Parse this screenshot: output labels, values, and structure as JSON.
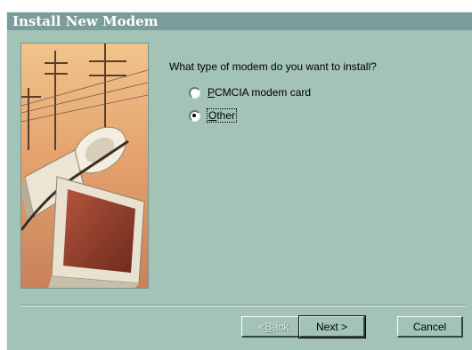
{
  "window": {
    "title": "Install New Modem"
  },
  "main": {
    "prompt": "What type of modem do you want to install?",
    "options": [
      {
        "pre": "",
        "accel": "P",
        "post": "CMCIA modem card",
        "selected": false
      },
      {
        "pre": "",
        "accel": "O",
        "post": "ther",
        "selected": true
      }
    ]
  },
  "buttons": {
    "back": {
      "pre": "< ",
      "accel": "B",
      "post": "ack",
      "enabled": false
    },
    "next": {
      "label": "Next >"
    },
    "cancel": {
      "label": "Cancel"
    }
  },
  "colors": {
    "dialog_bg": "#a2c3b6",
    "titlebar": "#7a9c9a"
  }
}
